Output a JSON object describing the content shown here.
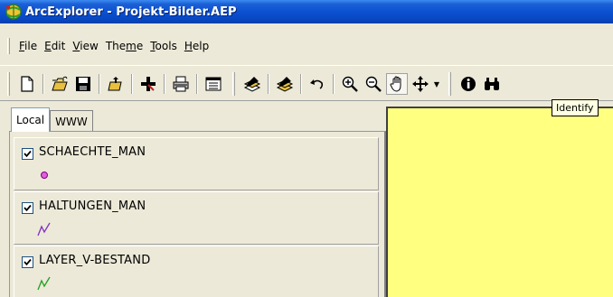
{
  "window": {
    "title": "ArcExplorer - Projekt-Bilder.AEP",
    "app_icon": "arcexplorer-globe-icon"
  },
  "menu": {
    "items": [
      {
        "label": "File",
        "underline": "F"
      },
      {
        "label": "Edit",
        "underline": "E"
      },
      {
        "label": "View",
        "underline": "V"
      },
      {
        "label": "Theme",
        "underline": "m"
      },
      {
        "label": "Tools",
        "underline": "T"
      },
      {
        "label": "Help",
        "underline": "H"
      }
    ]
  },
  "toolbar": {
    "buttons": [
      "new-icon",
      "open-icon",
      "save-icon",
      "open-project-icon",
      "add-theme-icon",
      "print-icon",
      "legend-toggle-icon",
      "theme-properties-icon",
      "theme-properties-edit-icon",
      "undo-icon",
      "zoom-in-icon",
      "zoom-out-icon",
      "pan-hand-icon",
      "pan-move-icon",
      "identify-icon",
      "find-icon"
    ],
    "pressed": "pan-hand-icon"
  },
  "tooltip": {
    "text": "Identify"
  },
  "tabs": [
    {
      "label": "Local",
      "active": true
    },
    {
      "label": "WWW",
      "active": false
    }
  ],
  "layers": [
    {
      "name": "SCHAECHTE_MAN",
      "checked": true,
      "symbol": "point",
      "color": "#e060e0"
    },
    {
      "name": "HALTUNGEN_MAN",
      "checked": true,
      "symbol": "line",
      "color": "#8030c0"
    },
    {
      "name": "LAYER_V-BESTAND",
      "checked": true,
      "symbol": "line",
      "color": "#20a020"
    }
  ],
  "map": {
    "background": "#ffff80"
  }
}
